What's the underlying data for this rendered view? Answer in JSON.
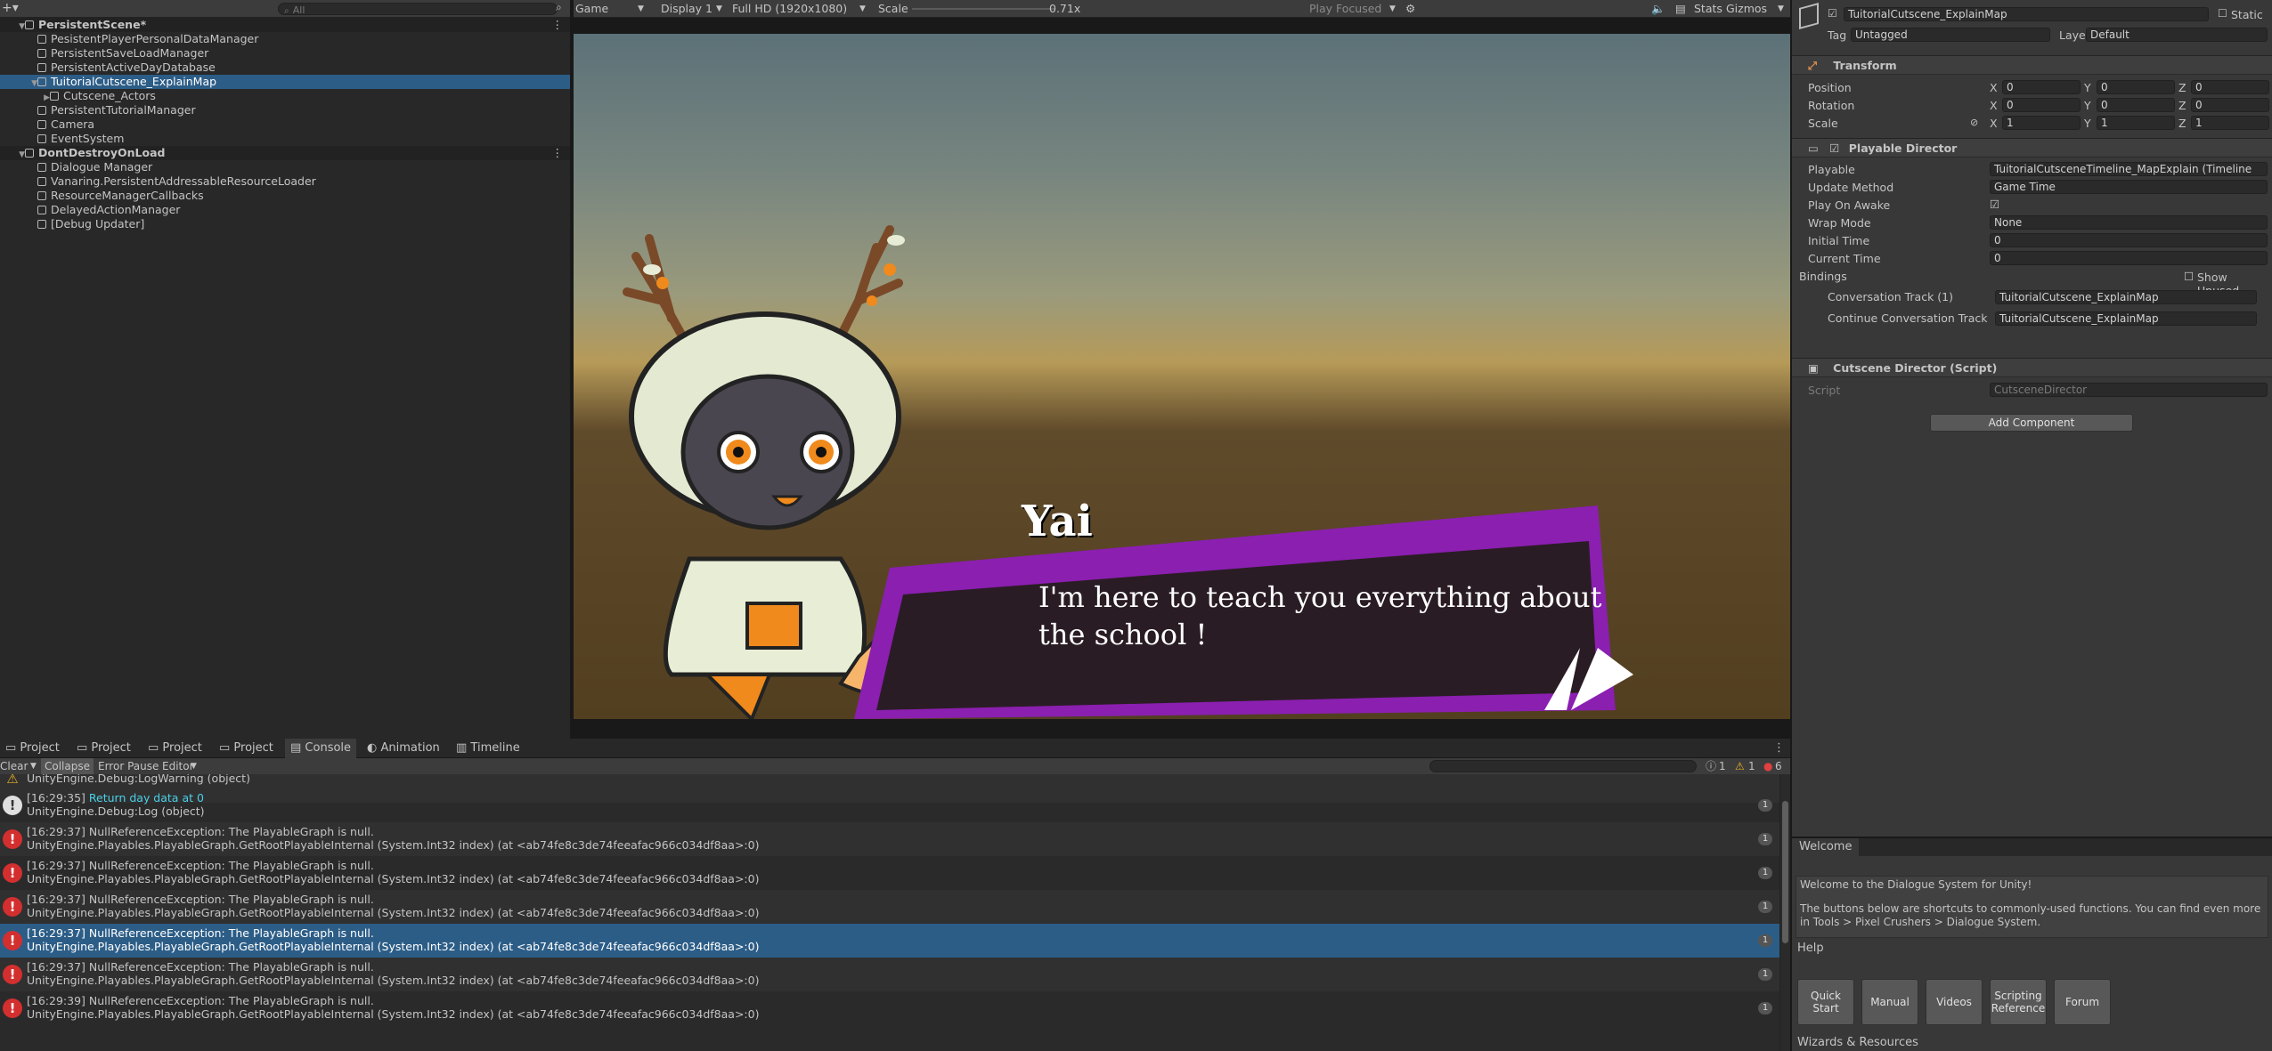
{
  "hierarchy": {
    "search_placeholder": "All",
    "items": [
      {
        "label": "PersistentScene*",
        "type": "scene"
      },
      {
        "label": "PesistentPlayerPersonalDataManager"
      },
      {
        "label": "PersistentSaveLoadManager"
      },
      {
        "label": "PersistentActiveDayDatabase"
      },
      {
        "label": "TuitorialCutscene_ExplainMap",
        "selected": true
      },
      {
        "label": "Cutscene_Actors"
      },
      {
        "label": "PersistentTutorialManager"
      },
      {
        "label": "Camera"
      },
      {
        "label": "EventSystem"
      },
      {
        "label": "DontDestroyOnLoad",
        "type": "scene"
      },
      {
        "label": "Dialogue Manager"
      },
      {
        "label": "Vanaring.PersistentAddressableResourceLoader"
      },
      {
        "label": "ResourceManagerCallbacks"
      },
      {
        "label": "DelayedActionManager"
      },
      {
        "label": "[Debug Updater]"
      }
    ]
  },
  "game_toolbar": {
    "view": "Game",
    "display": "Display 1",
    "resolution": "Full HD (1920x1080)",
    "scale_label": "Scale",
    "scale_value": "0.71x",
    "play_mode": "Play Focused",
    "stats": "Stats",
    "gizmos": "Gizmos"
  },
  "dialogue": {
    "speaker": "Yai",
    "line": "I'm here to teach you everything about the school !"
  },
  "bottom_tabs": [
    "Project",
    "Project",
    "Project",
    "Project",
    "Console",
    "Animation",
    "Timeline"
  ],
  "console_toolbar": {
    "clear": "Clear",
    "collapse": "Collapse",
    "error_pause": "Error Pause",
    "editor": "Editor",
    "count_log": "1",
    "count_warn": "1",
    "count_err": "6"
  },
  "console": [
    {
      "line1": "UnityEngine.Debug:LogWarning (object)",
      "line2": "",
      "kind": "warn-tail"
    },
    {
      "time": "[16:29:35]",
      "msg": "Return day data at 0",
      "line2": "UnityEngine.Debug:Log (object)",
      "kind": "log",
      "count": "1"
    },
    {
      "line1": "[16:29:37] NullReferenceException: The PlayableGraph is null.",
      "line2": "UnityEngine.Playables.PlayableGraph.GetRootPlayableInternal (System.Int32 index) (at <ab74fe8c3de74feeafac966c034df8aa>:0)",
      "kind": "error",
      "count": "1"
    },
    {
      "line1": "[16:29:37] NullReferenceException: The PlayableGraph is null.",
      "line2": "UnityEngine.Playables.PlayableGraph.GetRootPlayableInternal (System.Int32 index) (at <ab74fe8c3de74feeafac966c034df8aa>:0)",
      "kind": "error",
      "count": "1"
    },
    {
      "line1": "[16:29:37] NullReferenceException: The PlayableGraph is null.",
      "line2": "UnityEngine.Playables.PlayableGraph.GetRootPlayableInternal (System.Int32 index) (at <ab74fe8c3de74feeafac966c034df8aa>:0)",
      "kind": "error",
      "count": "1"
    },
    {
      "line1": "[16:29:37] NullReferenceException: The PlayableGraph is null.",
      "line2": "UnityEngine.Playables.PlayableGraph.GetRootPlayableInternal (System.Int32 index) (at <ab74fe8c3de74feeafac966c034df8aa>:0)",
      "kind": "error",
      "count": "1",
      "selected": true
    },
    {
      "line1": "[16:29:37] NullReferenceException: The PlayableGraph is null.",
      "line2": "UnityEngine.Playables.PlayableGraph.GetRootPlayableInternal (System.Int32 index) (at <ab74fe8c3de74feeafac966c034df8aa>:0)",
      "kind": "error",
      "count": "1"
    },
    {
      "line1": "[16:29:39] NullReferenceException: The PlayableGraph is null.",
      "line2": "UnityEngine.Playables.PlayableGraph.GetRootPlayableInternal (System.Int32 index) (at <ab74fe8c3de74feeafac966c034df8aa>:0)",
      "kind": "error",
      "count": "1"
    }
  ],
  "inspector": {
    "object_name": "TuitorialCutscene_ExplainMap",
    "static": "Static",
    "tag_label": "Tag",
    "tag_value": "Untagged",
    "layer_label": "Layer",
    "layer_value": "Default",
    "transform": {
      "title": "Transform",
      "position_label": "Position",
      "rotation_label": "Rotation",
      "scale_label": "Scale",
      "x": "X",
      "y": "Y",
      "z": "Z",
      "pos": [
        "0",
        "0",
        "0"
      ],
      "rot": [
        "0",
        "0",
        "0"
      ],
      "scl": [
        "1",
        "1",
        "1"
      ]
    },
    "director": {
      "title": "Playable Director",
      "playable_label": "Playable",
      "playable_value": "TuitorialCutsceneTimeline_MapExplain (Timeline",
      "update_label": "Update Method",
      "update_value": "Game Time",
      "play_on_awake_label": "Play On Awake",
      "wrap_label": "Wrap Mode",
      "wrap_value": "None",
      "initial_label": "Initial Time",
      "initial_value": "0",
      "current_label": "Current Time",
      "current_value": "0",
      "bindings_label": "Bindings",
      "show_unused": "Show Unused",
      "binding1_label": "Conversation Track (1)",
      "binding1_value": "TuitorialCutscene_ExplainMap",
      "binding2_label": "Continue Conversation Track",
      "binding2_value": "TuitorialCutscene_ExplainMap"
    },
    "cutscene": {
      "title": "Cutscene Director (Script)",
      "script_label": "Script",
      "script_value": "CutsceneDirector"
    },
    "add_component": "Add Component"
  },
  "welcome": {
    "tab": "Welcome",
    "line1": "Welcome to the Dialogue System for Unity!",
    "line2": "The buttons below are shortcuts to commonly-used functions. You can find even more in Tools > Pixel Crushers > Dialogue System.",
    "help": "Help",
    "buttons": [
      "Quick Start",
      "Manual",
      "Videos",
      "Scripting Reference",
      "Forum"
    ],
    "wizards": "Wizards & Resources"
  }
}
